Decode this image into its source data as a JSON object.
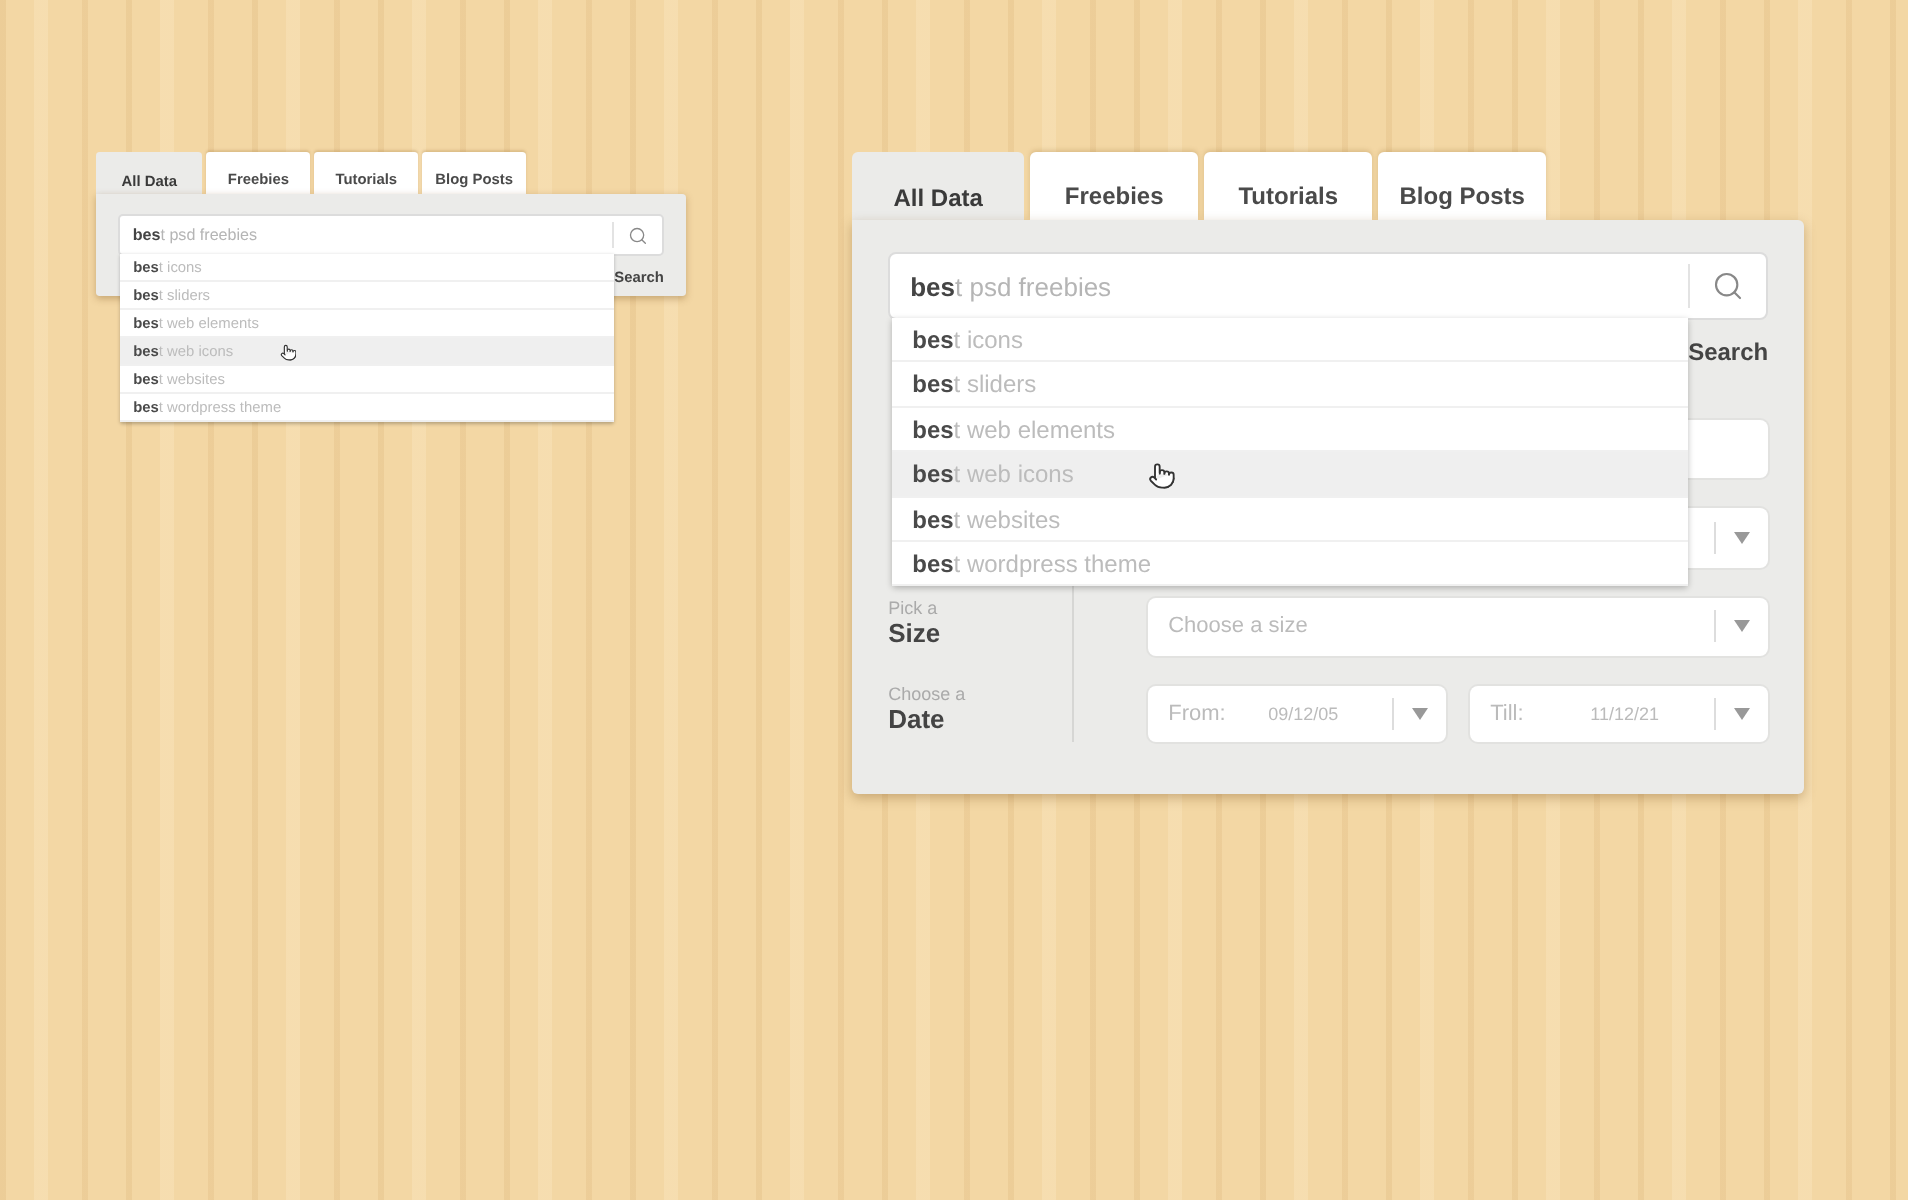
{
  "widgets": [
    {
      "kind": "compact",
      "tabs": [
        {
          "label": "All Data",
          "selected": true
        },
        {
          "label": "Freebies",
          "selected": false
        },
        {
          "label": "Tutorials",
          "selected": false
        },
        {
          "label": "Blog Posts",
          "selected": false
        }
      ],
      "query": "**bes**t psd freebies",
      "search_label": "Search",
      "suggestions": [
        {
          "text": "**bes**t icons",
          "selected": false
        },
        {
          "text": "**bes**t sliders",
          "selected": false
        },
        {
          "text": "**bes**t web elements",
          "selected": false
        },
        {
          "text": "**bes**t web icons",
          "selected": true
        },
        {
          "text": "**bes**t websites",
          "selected": false
        },
        {
          "text": "**bes**t wordpress theme",
          "selected": false
        }
      ]
    },
    {
      "kind": "full",
      "tabs": [
        {
          "label": "All Data",
          "selected": true
        },
        {
          "label": "Freebies",
          "selected": false
        },
        {
          "label": "Tutorials",
          "selected": false
        },
        {
          "label": "Blog Posts",
          "selected": false
        }
      ],
      "query": "**bes**t psd freebies",
      "search_label": "Search",
      "suggestions": [
        {
          "text": "**bes**t icons",
          "selected": false
        },
        {
          "text": "**bes**t sliders",
          "selected": false
        },
        {
          "text": "**bes**t web elements",
          "selected": false
        },
        {
          "text": "**bes**t web icons",
          "selected": true
        },
        {
          "text": "**bes**t websites",
          "selected": false
        },
        {
          "text": "**bes**t wordpress theme",
          "selected": false
        }
      ],
      "filters": [
        {
          "kind": "field"
        },
        {
          "kind": "select"
        },
        {
          "kind": "select",
          "hint": "Pick a",
          "label": "Size",
          "placeholder": "Choose a size"
        },
        {
          "kind": "dates",
          "hint": "Choose a",
          "label": "Date",
          "from_label": "From:",
          "from": "09/12/05",
          "till_label": "Till:",
          "till": "11/12/21"
        }
      ]
    }
  ]
}
